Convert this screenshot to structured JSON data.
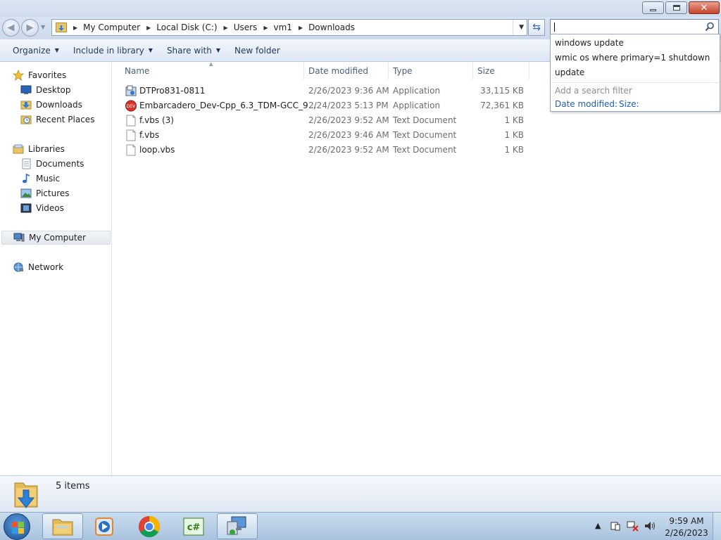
{
  "window": {
    "title": "",
    "controls": {
      "minimize": "minimize",
      "maximize": "maximize",
      "close": "close"
    }
  },
  "address": {
    "crumbs": [
      "My Computer",
      "Local Disk (C:)",
      "Users",
      "vm1",
      "Downloads"
    ]
  },
  "search": {
    "value": "",
    "suggestions": [
      "windows update",
      "wmic os where primary=1 shutdown",
      "update"
    ],
    "filter_title": "Add a search filter",
    "filters": [
      "Date modified:",
      "Size:"
    ]
  },
  "toolbar": {
    "organize": "Organize",
    "include": "Include in library",
    "share": "Share with",
    "new_folder": "New folder"
  },
  "nav": {
    "favorites": "Favorites",
    "desktop": "Desktop",
    "downloads": "Downloads",
    "recent": "Recent Places",
    "libraries": "Libraries",
    "documents": "Documents",
    "music": "Music",
    "pictures": "Pictures",
    "videos": "Videos",
    "computer": "My Computer",
    "network": "Network"
  },
  "columns": {
    "name": "Name",
    "date": "Date modified",
    "type": "Type",
    "size": "Size"
  },
  "files": [
    {
      "name": "DTPro831-0811",
      "date": "2/26/2023 9:36 AM",
      "type": "Application",
      "size": "33,115 KB",
      "icon": "installer-icon"
    },
    {
      "name": "Embarcadero_Dev-Cpp_6.3_TDM-GCC_9....",
      "date": "2/24/2023 5:13 PM",
      "type": "Application",
      "size": "72,361 KB",
      "icon": "devcpp-icon"
    },
    {
      "name": "f.vbs (3)",
      "date": "2/26/2023 9:52 AM",
      "type": "Text Document",
      "size": "1 KB",
      "icon": "text-file-icon"
    },
    {
      "name": "f.vbs",
      "date": "2/26/2023 9:46 AM",
      "type": "Text Document",
      "size": "1 KB",
      "icon": "text-file-icon"
    },
    {
      "name": "loop.vbs",
      "date": "2/26/2023 9:52 AM",
      "type": "Text Document",
      "size": "1 KB",
      "icon": "text-file-icon"
    }
  ],
  "details": {
    "count": "5 items"
  },
  "taskbar": {
    "apps": [
      "explorer",
      "media-player",
      "chrome",
      "csharp-editor",
      "computer-app"
    ],
    "time": "9:59 AM",
    "date": "2/26/2023"
  },
  "colors": {
    "accent": "#1e5ebb",
    "titlebar": "#d5e1ef",
    "taskbar": "#b9d0e6",
    "close": "#c7432b"
  }
}
